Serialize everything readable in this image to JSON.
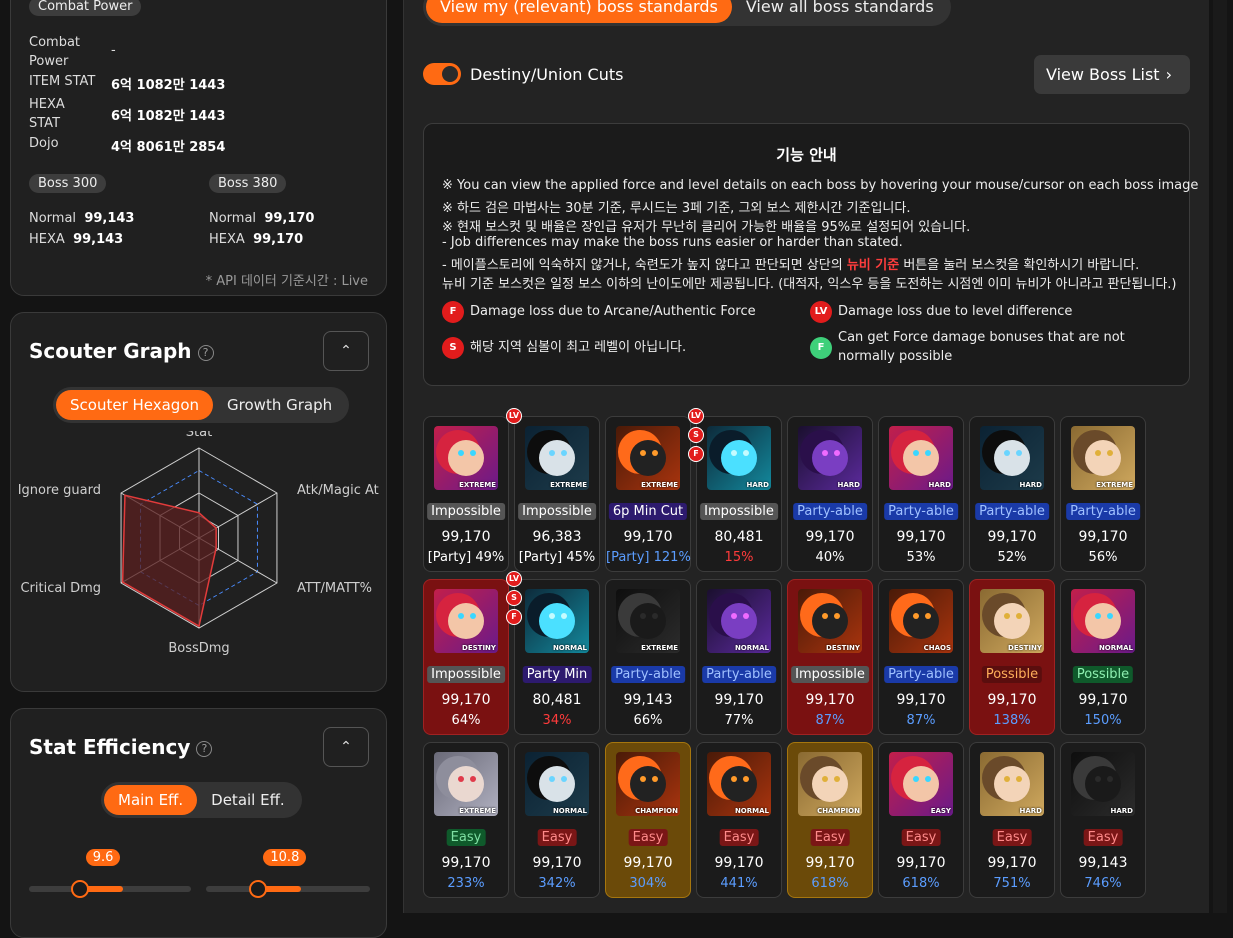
{
  "combat": {
    "tag": "Combat Power",
    "rows": [
      {
        "label": "Combat Power",
        "value": "-"
      },
      {
        "label": "ITEM STAT",
        "value": "6억 1082만 1443"
      },
      {
        "label": "HEXA STAT",
        "value": "6억 1082만 1443"
      },
      {
        "label": "Dojo",
        "value": "4억 8061만 2854"
      }
    ],
    "boss300": {
      "tag": "Boss 300",
      "normal_label": "Normal",
      "normal": "99,143",
      "hexa_label": "HEXA",
      "hexa": "99,143"
    },
    "boss380": {
      "tag": "Boss 380",
      "normal_label": "Normal",
      "normal": "99,170",
      "hexa_label": "HEXA",
      "hexa": "99,170"
    },
    "api_note": "* API 데이터 기준시간 : Live"
  },
  "scouter": {
    "title": "Scouter Graph",
    "help": "?",
    "collapse_icon": "chevron-up-icon",
    "tabs": [
      "Scouter Hexagon",
      "Growth Graph"
    ],
    "active_tab": 0,
    "axes": [
      "Stat",
      "Atk/Magic At",
      "ATT/MATT%",
      "BossDmg",
      "Critical Dmg",
      "Ignore guard"
    ],
    "values": [
      0.28,
      0.22,
      0.22,
      0.98,
      0.98,
      0.95
    ],
    "colors": {
      "grid": "#cfcfcf",
      "dashed": "#4a8cff",
      "fill": "#5a1f1f",
      "line": "#e23b3b"
    }
  },
  "stat_eff": {
    "title": "Stat Efficiency",
    "help": "?",
    "tabs": [
      "Main Eff.",
      "Detail Eff."
    ],
    "active_tab": 0,
    "slider1_value": "9.6",
    "slider1_level": 0.45,
    "slider2_value": "10.8",
    "slider2_level": 0.45
  },
  "top_tabs": [
    "View my (relevant) boss standards",
    "View all boss standards"
  ],
  "toggle_label": "Destiny/Union Cuts",
  "boss_list_btn": "View Boss List",
  "notice": {
    "title": "기능 안내",
    "lines": [
      "※ You can view the applied force and level details on each boss by hovering your mouse/cursor on each boss image",
      "※ 하드 검은 마법사는 30분 기준, 루시드는 3페 기준, 그외 보스 제한시간 기준입니다.",
      "※ 현재 보스컷 및 배율은 장인급 유저가 무난히 클리어 가능한 배율을 95%로 설정되어 있습니다.",
      "- Job differences may make the boss runs easier or harder than stated."
    ],
    "line5_pre": "- 메이플스토리에 익숙하지 않거나, 숙련도가 높지 않다고 판단되면 상단의 ",
    "line5_red": "뉴비 기준",
    "line5_post": " 버튼을 눌러 보스컷을 확인하시기 바랍니다.",
    "line6": "뉴비 기준 보스컷은 일정 보스 이하의 난이도에만 제공됩니다. (대적자, 익스우 등을 도전하는 시점엔 이미 뉴비가 아니라고 판단됩니다.)",
    "legend": [
      {
        "sym": "F",
        "text": "Damage loss due to Arcane/Authentic Force",
        "color": "#e21c1c"
      },
      {
        "sym": "LV",
        "text": "Damage loss due to level difference",
        "color": "#e21c1c"
      },
      {
        "sym": "S",
        "text": "해당 지역 심볼이 최고 레벨이 아닙니다.",
        "color": "#e21c1c"
      },
      {
        "sym": "F",
        "text": "Can get Force damage bonuses that are not normally possible",
        "color": "#3ed07a"
      }
    ]
  },
  "bosses": [
    {
      "diff": "EXTREME",
      "art": "pink",
      "status": "Impossible",
      "sc": "imp",
      "cp": "99,170",
      "pct": "[Party] 49%",
      "pc": "",
      "cell": "",
      "marks": []
    },
    {
      "diff": "EXTREME",
      "art": "dark",
      "status": "Impossible",
      "sc": "imp",
      "cp": "96,383",
      "pct": "[Party] 45%",
      "pc": "",
      "cell": "",
      "marks": [
        "LV"
      ]
    },
    {
      "diff": "EXTREME",
      "art": "fire",
      "status": "6p Min Cut",
      "sc": "min",
      "cp": "99,170",
      "pct": "[Party] 121%",
      "pc": "blue",
      "cell": "",
      "marks": []
    },
    {
      "diff": "HARD",
      "art": "cyan",
      "status": "Impossible",
      "sc": "imp",
      "cp": "80,481",
      "pct": "15%",
      "pc": "redt",
      "cell": "",
      "marks": [
        "LV",
        "S",
        "F"
      ]
    },
    {
      "diff": "HARD",
      "art": "purple",
      "status": "Party-able",
      "sc": "party",
      "cp": "99,170",
      "pct": "40%",
      "pc": "",
      "cell": "",
      "marks": []
    },
    {
      "diff": "HARD",
      "art": "pink",
      "status": "Party-able",
      "sc": "party",
      "cp": "99,170",
      "pct": "53%",
      "pc": "",
      "cell": "",
      "marks": []
    },
    {
      "diff": "HARD",
      "art": "dark",
      "status": "Party-able",
      "sc": "party",
      "cp": "99,170",
      "pct": "52%",
      "pc": "",
      "cell": "",
      "marks": []
    },
    {
      "diff": "EXTREME",
      "art": "blonde",
      "status": "Party-able",
      "sc": "party",
      "cp": "99,170",
      "pct": "56%",
      "pc": "",
      "cell": "",
      "marks": []
    },
    {
      "diff": "DESTINY",
      "art": "pink",
      "status": "Impossible",
      "sc": "imp",
      "cp": "99,170",
      "pct": "64%",
      "pc": "",
      "cell": "bad",
      "marks": []
    },
    {
      "diff": "NORMAL",
      "art": "cyan",
      "status": "Party Min",
      "sc": "min",
      "cp": "80,481",
      "pct": "34%",
      "pc": "redt",
      "cell": "",
      "marks": [
        "LV",
        "S",
        "F"
      ]
    },
    {
      "diff": "EXTREME",
      "art": "hood",
      "status": "Party-able",
      "sc": "party",
      "cp": "99,143",
      "pct": "66%",
      "pc": "",
      "cell": "",
      "marks": []
    },
    {
      "diff": "NORMAL",
      "art": "purple",
      "status": "Party-able",
      "sc": "party",
      "cp": "99,170",
      "pct": "77%",
      "pc": "",
      "cell": "",
      "marks": []
    },
    {
      "diff": "DESTINY",
      "art": "fire",
      "status": "Impossible",
      "sc": "imp",
      "cp": "99,170",
      "pct": "87%",
      "pc": "blue",
      "cell": "bad",
      "marks": []
    },
    {
      "diff": "CHAOS",
      "art": "fire",
      "status": "Party-able",
      "sc": "party",
      "cp": "99,170",
      "pct": "87%",
      "pc": "blue",
      "cell": "",
      "marks": []
    },
    {
      "diff": "DESTINY",
      "art": "blonde",
      "status": "Possible",
      "sc": "poss-r",
      "cp": "99,170",
      "pct": "138%",
      "pc": "blue",
      "cell": "bad",
      "marks": []
    },
    {
      "diff": "NORMAL",
      "art": "pink",
      "status": "Possible",
      "sc": "poss-g",
      "cp": "99,170",
      "pct": "150%",
      "pc": "blue",
      "cell": "",
      "marks": []
    },
    {
      "diff": "EXTREME",
      "art": "silver",
      "status": "Easy",
      "sc": "easy-g",
      "cp": "99,170",
      "pct": "233%",
      "pc": "blue",
      "cell": "",
      "marks": []
    },
    {
      "diff": "NORMAL",
      "art": "dark",
      "status": "Easy",
      "sc": "easy-r",
      "cp": "99,170",
      "pct": "342%",
      "pc": "blue",
      "cell": "",
      "marks": []
    },
    {
      "diff": "CHAMPION",
      "art": "fire",
      "status": "Easy",
      "sc": "easy-r",
      "cp": "99,170",
      "pct": "304%",
      "pc": "blue",
      "cell": "gold",
      "marks": []
    },
    {
      "diff": "NORMAL",
      "art": "fire",
      "status": "Easy",
      "sc": "easy-r",
      "cp": "99,170",
      "pct": "441%",
      "pc": "blue",
      "cell": "",
      "marks": []
    },
    {
      "diff": "CHAMPION",
      "art": "blonde",
      "status": "Easy",
      "sc": "easy-r",
      "cp": "99,170",
      "pct": "618%",
      "pc": "blue",
      "cell": "gold",
      "marks": []
    },
    {
      "diff": "EASY",
      "art": "pink",
      "status": "Easy",
      "sc": "easy-r",
      "cp": "99,170",
      "pct": "618%",
      "pc": "blue",
      "cell": "",
      "marks": []
    },
    {
      "diff": "HARD",
      "art": "blonde",
      "status": "Easy",
      "sc": "easy-r",
      "cp": "99,170",
      "pct": "751%",
      "pc": "blue",
      "cell": "",
      "marks": []
    },
    {
      "diff": "HARD",
      "art": "hood",
      "status": "Easy",
      "sc": "easy-r",
      "cp": "99,143",
      "pct": "746%",
      "pc": "blue",
      "cell": "",
      "marks": []
    }
  ],
  "colors": {
    "accent": "#ff6a13",
    "panel": "#202020",
    "bg": "#141414"
  }
}
